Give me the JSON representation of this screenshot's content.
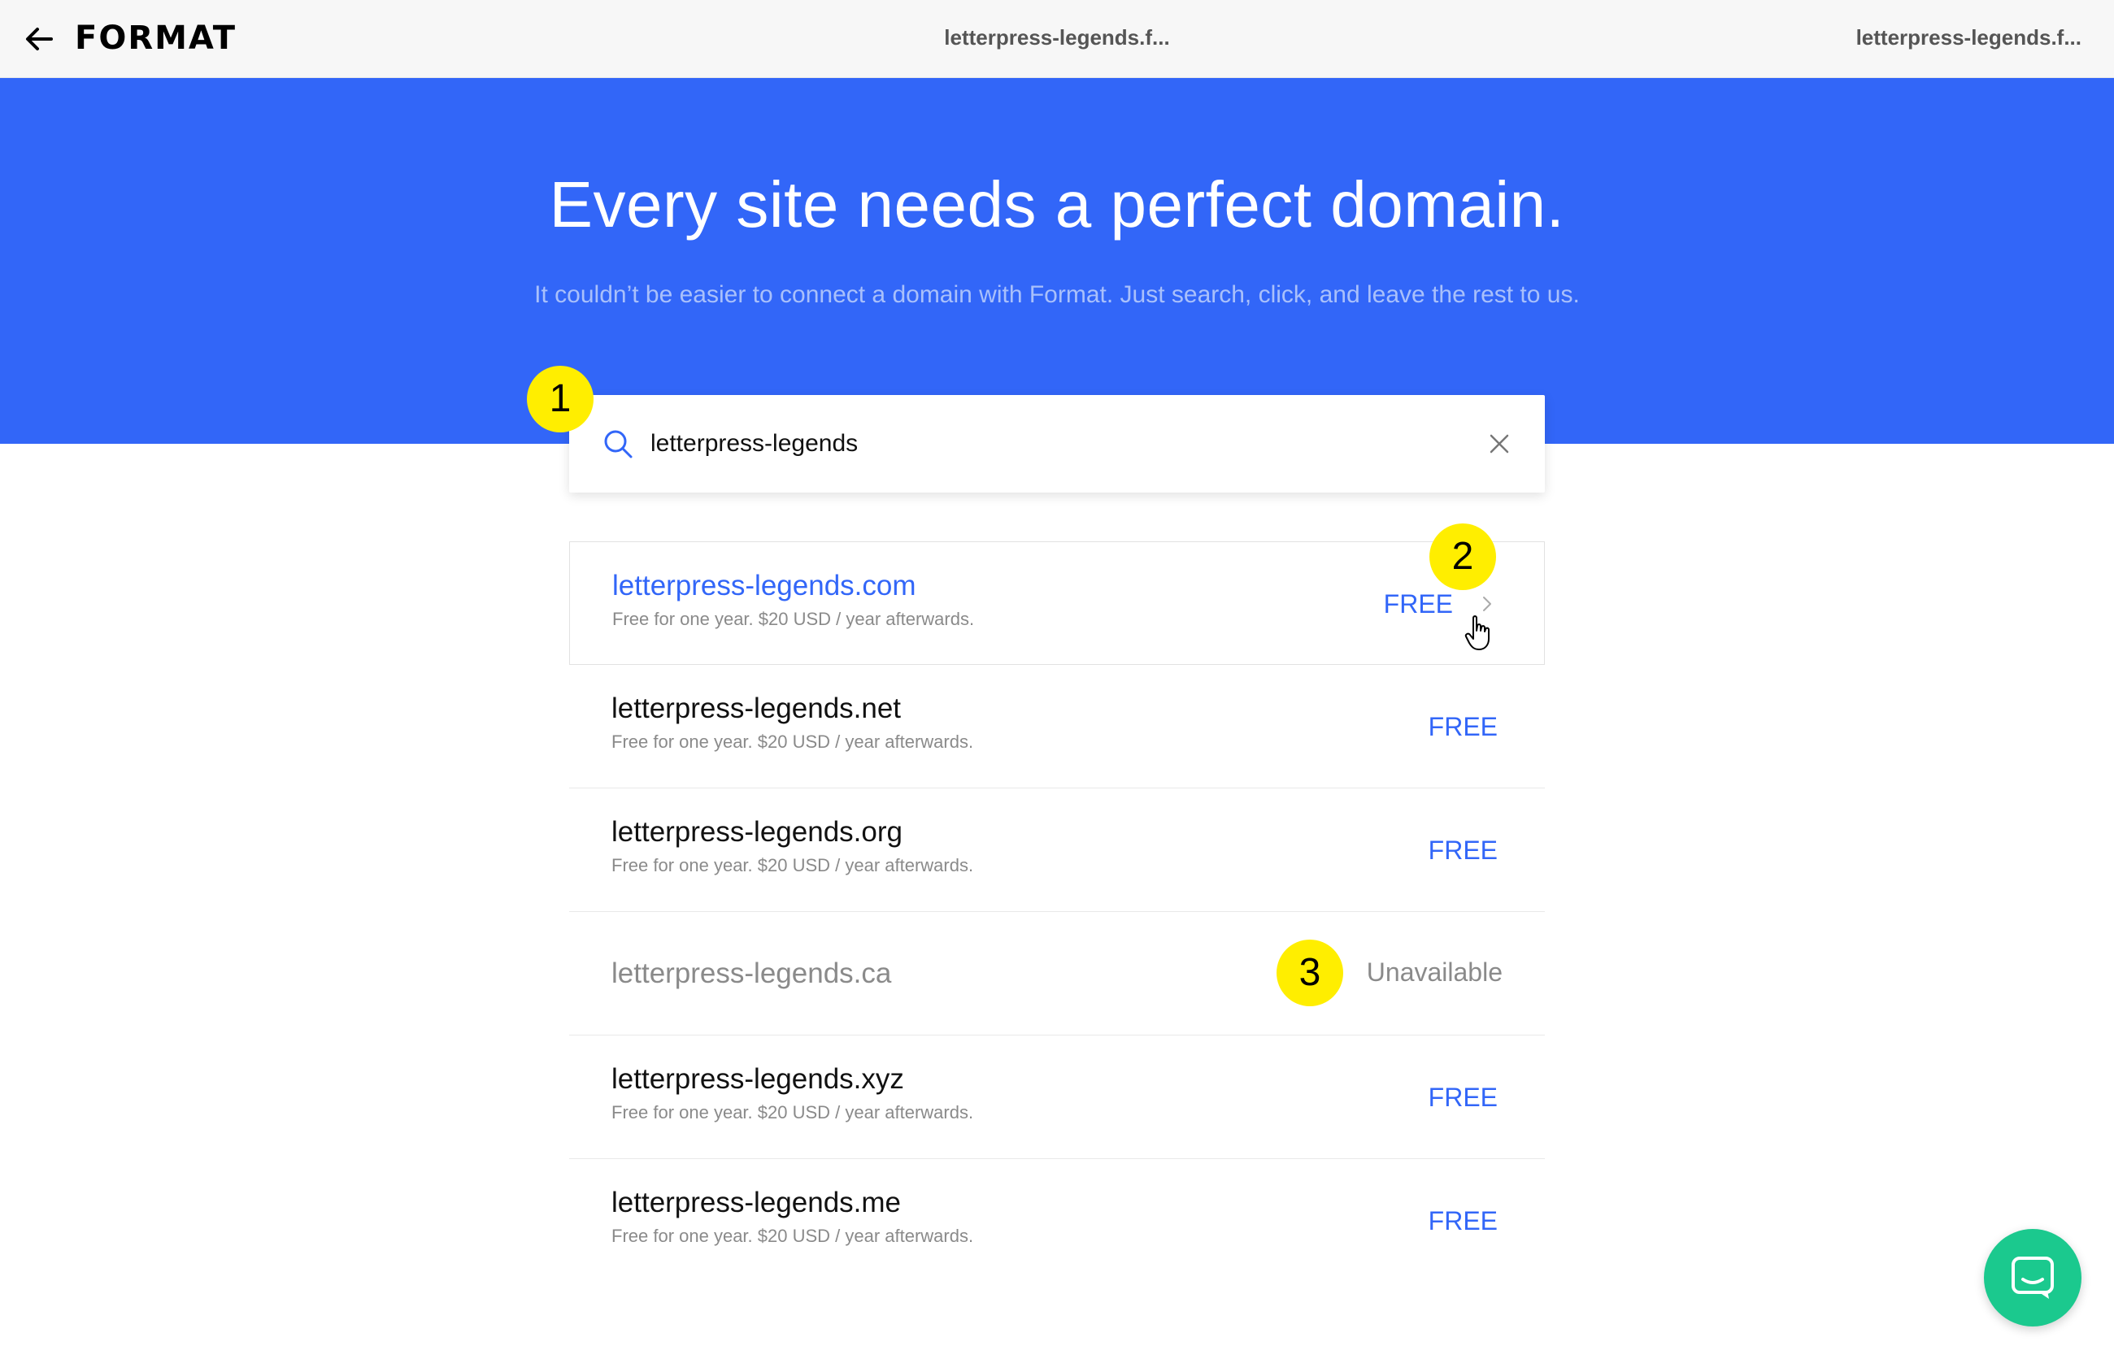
{
  "header": {
    "logo": "FORMAT",
    "breadcrumb_center": "letterpress-legends.f...",
    "breadcrumb_right": "letterpress-legends.f..."
  },
  "hero": {
    "title": "Every site needs a perfect domain.",
    "subtitle": "It couldn’t be easier to connect a domain with Format. Just search, click, and leave the rest to us."
  },
  "search": {
    "value": "letterpress-legends"
  },
  "results": [
    {
      "domain": "letterpress-legends.com",
      "subtext": "Free for one year. $20 USD / year afterwards.",
      "price": "FREE",
      "status": "available"
    },
    {
      "domain": "letterpress-legends.net",
      "subtext": "Free for one year. $20 USD / year afterwards.",
      "price": "FREE",
      "status": "available"
    },
    {
      "domain": "letterpress-legends.org",
      "subtext": "Free for one year. $20 USD / year afterwards.",
      "price": "FREE",
      "status": "available"
    },
    {
      "domain": "letterpress-legends.ca",
      "subtext": "",
      "price": "Unavailable",
      "status": "unavailable"
    },
    {
      "domain": "letterpress-legends.xyz",
      "subtext": "Free for one year. $20 USD / year afterwards.",
      "price": "FREE",
      "status": "available"
    },
    {
      "domain": "letterpress-legends.me",
      "subtext": "Free for one year. $20 USD / year afterwards.",
      "price": "FREE",
      "status": "available"
    }
  ],
  "annotations": {
    "marker_1": "1",
    "marker_2": "2",
    "marker_3": "3"
  },
  "colors": {
    "brand_blue": "#3266f8",
    "chat_green": "#1bc98e",
    "marker_yellow": "#ffee00"
  },
  "icons": {
    "back": "arrow-left-icon",
    "search": "search-icon",
    "clear": "close-icon",
    "chevron": "chevron-right-icon",
    "cursor": "hand-pointer-icon",
    "chat": "chat-icon"
  }
}
